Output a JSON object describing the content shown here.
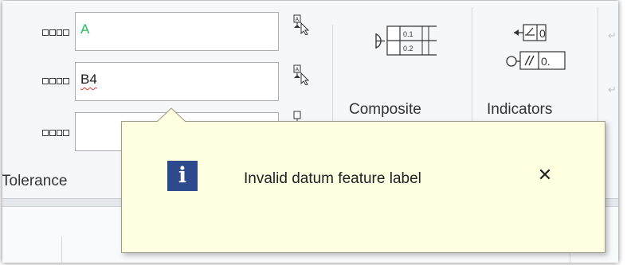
{
  "datum_fields": [
    {
      "value": "A",
      "state": "valid"
    },
    {
      "value": "B4",
      "state": "spelling-error"
    },
    {
      "value": "",
      "state": "empty"
    }
  ],
  "icons": {
    "row": "datum-row-icon",
    "selector": "datum-target-select-icon",
    "composite": "composite-frame-icon",
    "indicators": "indicators-icon"
  },
  "composite_symbol": {
    "upper": "0.1",
    "lower": "0.2"
  },
  "indicators_symbol": {
    "upper": "0",
    "lower": "0."
  },
  "groups": {
    "tolerance": "Tolerance",
    "composite": "Composite",
    "indicators": "Indicators"
  },
  "tooltip": {
    "message": "Invalid datum feature label",
    "close": "✕",
    "info_glyph": "i"
  },
  "colors": {
    "tooltip_bg": "#ffffe1",
    "info_icon_bg": "#2d4b8c",
    "valid_text": "#22c15a",
    "spell_underline": "#e0392b"
  }
}
